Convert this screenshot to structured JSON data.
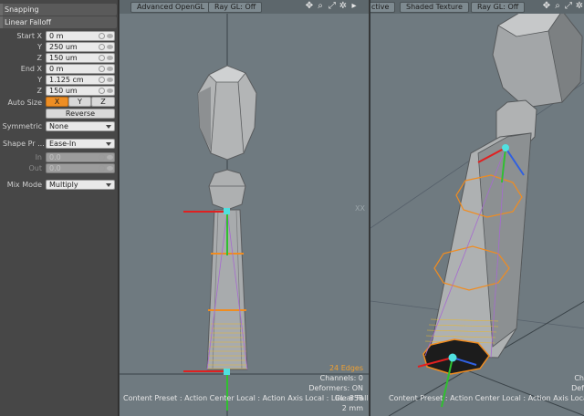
{
  "panel": {
    "sections": {
      "snapping": "Snapping",
      "linear_falloff": "Linear Falloff"
    },
    "start": {
      "x_label": "Start X",
      "y_label": "Y",
      "z_label": "Z",
      "x": "0 m",
      "y": "250 um",
      "z": "150 um"
    },
    "end": {
      "x_label": "End X",
      "y_label": "Y",
      "z_label": "Z",
      "x": "0 m",
      "y": "1.125 cm",
      "z": "150 um"
    },
    "auto_size": {
      "label": "Auto Size",
      "x": "X",
      "y": "Y",
      "z": "Z",
      "active": "X"
    },
    "reverse_label": "Reverse",
    "symmetric": {
      "label": "Symmetric",
      "value": "None"
    },
    "shape_preset": {
      "label": "Shape Pr ...",
      "value": "Ease-In"
    },
    "in": {
      "label": "In",
      "value": "0.0"
    },
    "out": {
      "label": "Out",
      "value": "0.0"
    },
    "mix_mode": {
      "label": "Mix Mode",
      "value": "Multiply"
    }
  },
  "viewport_left": {
    "tabs": [
      "Advanced OpenGL",
      "Ray GL: Off"
    ],
    "icons": [
      "axis-icon",
      "search-icon",
      "expand-icon",
      "gear-icon",
      "maximize-icon"
    ],
    "edges": "24 Edges",
    "channels": "Channels: 0",
    "deformers": "Deformers: ON",
    "gl": "GL: 858",
    "size": "2 mm",
    "footer": "Content Preset : Action Center Local : Action Axis Local : Linear Falloff Snap",
    "axis_mark": "XX"
  },
  "viewport_right": {
    "tabs": [
      "ctive",
      "Shaded Texture",
      "Ray GL: Off"
    ],
    "icons": [
      "axis-icon",
      "search-icon",
      "expand-icon",
      "gear-icon"
    ],
    "channels": "Ch",
    "deformers": "Def",
    "gl": "",
    "footer": "Content Preset : Action Center Local : Action Axis Local : Linear Falloff"
  },
  "colors": {
    "panel_bg": "#474747",
    "viewport_bg": "#6f7a80",
    "accent_orange": "#ee8e24",
    "falloff_yellow": "#e8b830",
    "handle_red": "#e02020",
    "handle_green": "#30c030",
    "handle_blue": "#3060e0",
    "handle_cyan": "#50e0e0"
  }
}
